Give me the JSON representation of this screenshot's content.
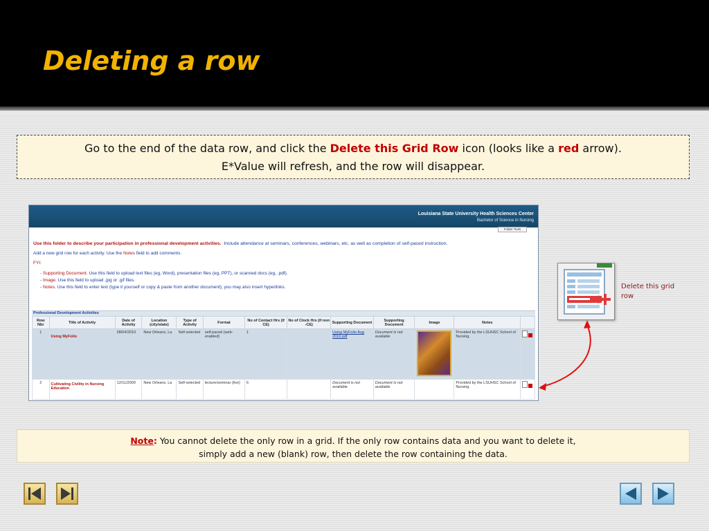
{
  "slide": {
    "title": "Deleting a row"
  },
  "callout": {
    "line1_pre": "Go to the end of the data row, and click the ",
    "line1_highlight": "Delete this Grid Row",
    "line1_mid": " icon (looks like a ",
    "line1_red": "red",
    "line1_post": " arrow).",
    "line2": "E*Value will refresh, and the row will disappear."
  },
  "screenshot": {
    "org_name": "Louisiana State University Health Sciences Center",
    "program": "Bachelor of Science in Nursing",
    "folder_select": "Folder Tools",
    "intro_bold": "Use this folder to describe your participation in professional development activities.",
    "intro_rest": "Include attendance at seminars, conferences, webinars, etc. as well as completion of self-paced instruction.",
    "add_row_pre": "Add a new grid row for each activity.  Use the ",
    "add_row_notes": "Notes",
    "add_row_post": " field to add comments.",
    "fyi": "FYI:",
    "bullets": [
      {
        "label": "Supporting Document.",
        "text": " Use this field to upload text files (eg, Word), presentation files (eg, PPT), or scanned docs (eg, .pdf)."
      },
      {
        "label": "Image.",
        "text": " Use this field to upload .jpg or .gif files."
      },
      {
        "label": "Notes.",
        "text": " Use this field to enter text (type it yourself or copy & paste from another document); you may also insert hyperlinks."
      }
    ],
    "section_title": "Professional Development Activities",
    "columns": [
      "Row Nbr",
      "Title of Activity",
      "Date of Activity",
      "Location (city/state)",
      "Type of Activity",
      "Format",
      "No of Contact Hrs (if CE)",
      "No of Clock Hrs (if non -CE)",
      "Supporting Document",
      "Supporting Document",
      "Image",
      "Notes",
      ""
    ],
    "rows": [
      {
        "nbr": "1",
        "title": "Using MyFolio",
        "date": "08/04/2010",
        "location": "New Orleans, La",
        "type": "Self-selected",
        "format": "self-paced (web-enabled)",
        "contact_hrs": "1",
        "clock_hrs": "",
        "doc1": "Using MyFolio Aug 2010.pdf",
        "doc2": "Document is not available",
        "notes": "Provided by the LSUHSC School of Nursing."
      },
      {
        "nbr": "2",
        "title": "Cultivating Civility in Nursing Education",
        "date": "12/11/2009",
        "location": "New Orleans, La",
        "type": "Self-selected",
        "format": "lecture/seminar (live)",
        "contact_hrs": "6",
        "clock_hrs": "",
        "doc1": "Document is not available",
        "doc2": "Document is not available",
        "notes": "Provided by the LSUHSC School of Nursing."
      }
    ]
  },
  "zoom": {
    "label": "Delete this grid row"
  },
  "note": {
    "label": "Note",
    "colon": ":",
    "text_line1": "  You cannot delete the only row in a grid.  If the only row contains data and you want to delete it,",
    "text_line2": "simply add a new (blank) row, then delete the row containing the data."
  },
  "colors": {
    "title": "#f2b300",
    "highlight_red": "#c00000",
    "header_blue": "#1e5b88"
  }
}
